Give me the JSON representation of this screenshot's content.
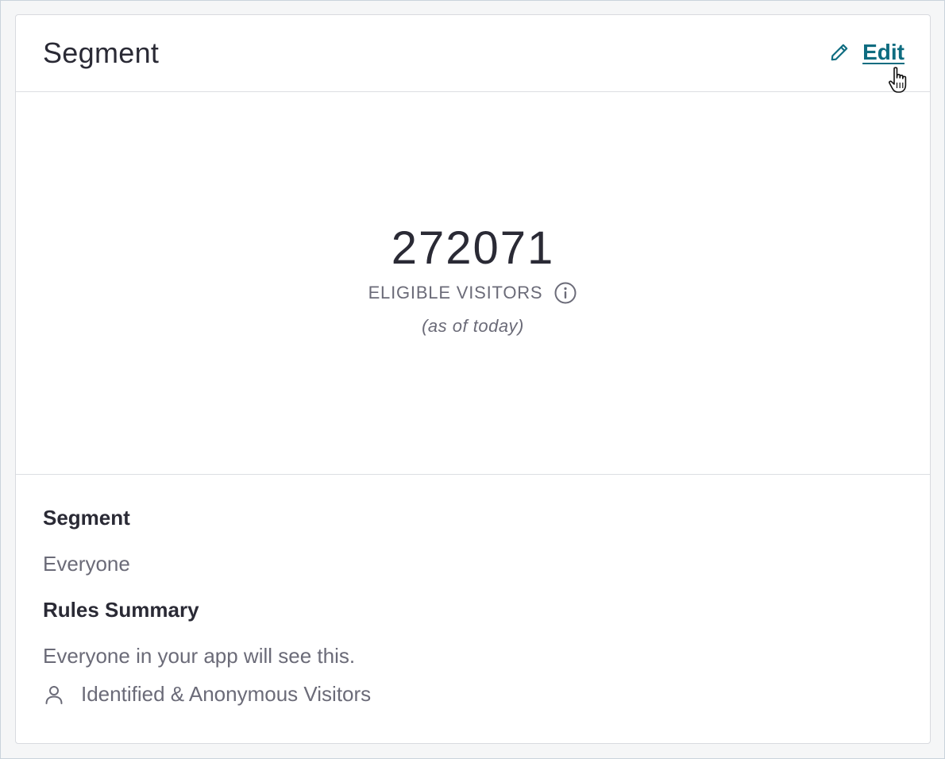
{
  "card": {
    "title": "Segment",
    "edit_label": "Edit"
  },
  "stats": {
    "visitor_count": "272071",
    "visitors_label": "ELIGIBLE VISITORS",
    "as_of": "(as of today)"
  },
  "details": {
    "segment_heading": "Segment",
    "segment_value": "Everyone",
    "rules_heading": "Rules Summary",
    "rules_text": "Everyone in your app will see this.",
    "visitor_type": "Identified & Anonymous Visitors"
  },
  "icons": {
    "edit": "pencil-icon",
    "info": "info-icon",
    "visitor_type": "person-icon",
    "cursor": "hand-pointer-cursor"
  },
  "colors": {
    "accent": "#0e6c80",
    "text_primary": "#2a2a35",
    "text_secondary": "#6b6b78",
    "border": "#dcdee2"
  }
}
